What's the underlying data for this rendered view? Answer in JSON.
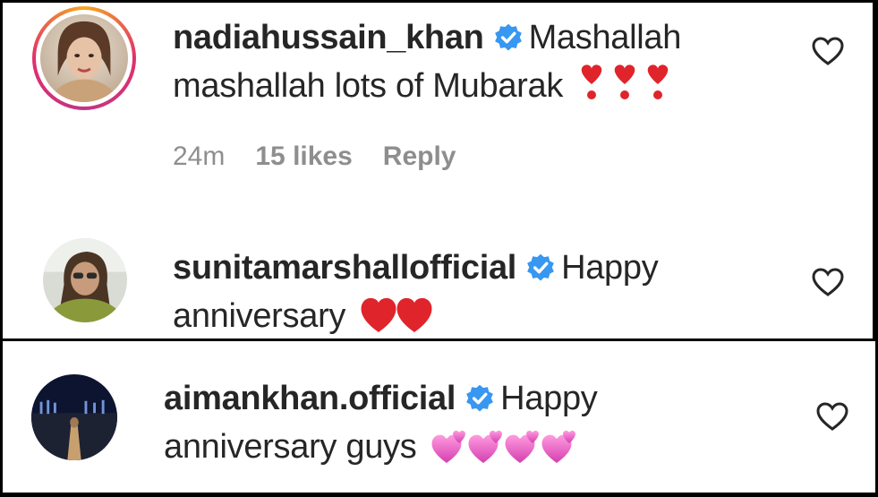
{
  "comments": [
    {
      "username": "nadiahussain_khan",
      "text_line1": "Mashallah",
      "text_line2": "mashallah lots of Mubarak",
      "emoji": "❣️❣️❣️",
      "time": "24m",
      "likes": "15 likes",
      "reply": "Reply",
      "has_story_ring": true
    },
    {
      "username": "sunitamarshallofficial",
      "text_line1": "Happy",
      "text_line2": "anniversary",
      "emoji": "❤️❤️"
    },
    {
      "username": "aimankhan.official",
      "text_line1": "Happy",
      "text_line2": "anniversary guys",
      "emoji": "💞💞💞💞"
    }
  ],
  "colors": {
    "text": "#262626",
    "meta": "#8e8e8e",
    "verified": "#3897f0",
    "heart_outline": "#262626",
    "ring": "#e1306c"
  },
  "icons": [
    "verified-badge-icon",
    "heart-outline-icon",
    "red-heart-exclamation-icon",
    "red-heart-icon",
    "revolving-hearts-icon"
  ]
}
